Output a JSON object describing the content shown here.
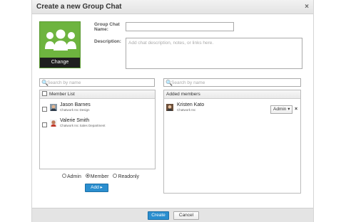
{
  "dialog": {
    "title": "Create a new Group Chat",
    "close_glyph": "×"
  },
  "avatar": {
    "icon": "group-people-icon",
    "change_label": "Change",
    "color": "#6eb43f"
  },
  "form": {
    "name_label_line1": "Group Chat",
    "name_label_line2": "Name:",
    "name_value": "",
    "description_label": "Description:",
    "description_placeholder": "Add chat description, notes, or links here.",
    "description_value": ""
  },
  "left_search": {
    "icon": "search-icon",
    "placeholder": "Search by name"
  },
  "right_search": {
    "icon": "search-icon",
    "placeholder": "Search by name"
  },
  "member_list": {
    "header": "Member List",
    "items": [
      {
        "name": "Jason Barnes",
        "company": "Chatwork Inc Design"
      },
      {
        "name": "Valerie Smith",
        "company": "Chatwork Inc Sales Department"
      }
    ]
  },
  "roles": {
    "options": [
      "Admin",
      "Member",
      "Readonly"
    ],
    "selected": "Member"
  },
  "add_button_label": "Add ▸",
  "added_members": {
    "header": "Added members",
    "items": [
      {
        "name": "Kristen Kato",
        "company": "Chatwork Inc",
        "role": "Admin ▾",
        "remove_glyph": "×"
      }
    ]
  },
  "footer": {
    "create_label": "Create",
    "cancel_label": "Cancel"
  },
  "colors": {
    "primary_button": "#2a8ecf",
    "avatar_green": "#6eb43f"
  }
}
